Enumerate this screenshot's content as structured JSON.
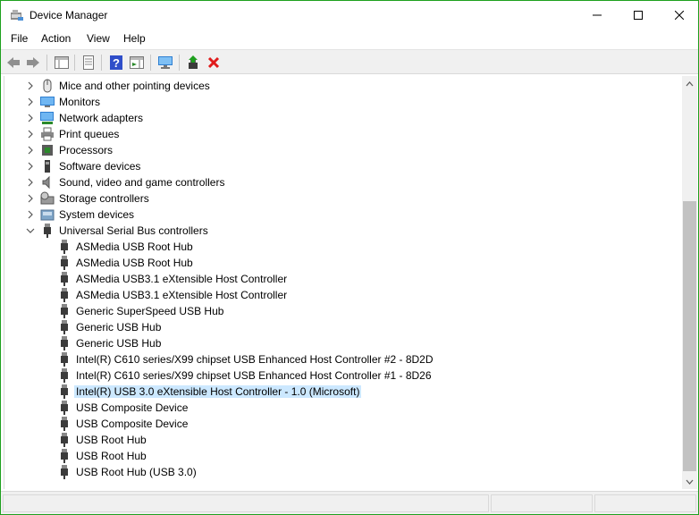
{
  "window": {
    "title": "Device Manager"
  },
  "menu": [
    "File",
    "Action",
    "View",
    "Help"
  ],
  "toolbar": {
    "buttons": [
      "back-arrow-icon",
      "forward-arrow-icon",
      "show-hide-console-tree-icon",
      "properties-icon",
      "help-icon",
      "action-pane-icon",
      "scan-hardware-icon",
      "update-driver-icon",
      "uninstall-device-icon"
    ]
  },
  "tree": {
    "categories": [
      {
        "label": "Mice and other pointing devices",
        "icon": "mouse-icon"
      },
      {
        "label": "Monitors",
        "icon": "monitor-icon"
      },
      {
        "label": "Network adapters",
        "icon": "network-adapter-icon"
      },
      {
        "label": "Print queues",
        "icon": "printer-icon"
      },
      {
        "label": "Processors",
        "icon": "processor-icon"
      },
      {
        "label": "Software devices",
        "icon": "software-device-icon"
      },
      {
        "label": "Sound, video and game controllers",
        "icon": "speaker-icon"
      },
      {
        "label": "Storage controllers",
        "icon": "storage-controller-icon"
      },
      {
        "label": "System devices",
        "icon": "system-device-icon"
      },
      {
        "label": "Universal Serial Bus controllers",
        "icon": "usb-icon"
      }
    ],
    "usb_devices": [
      "ASMedia USB Root Hub",
      "ASMedia USB Root Hub",
      "ASMedia USB3.1 eXtensible Host Controller",
      "ASMedia USB3.1 eXtensible Host Controller",
      "Generic SuperSpeed USB Hub",
      "Generic USB Hub",
      "Generic USB Hub",
      "Intel(R) C610 series/X99 chipset USB Enhanced Host Controller #2 - 8D2D",
      "Intel(R) C610 series/X99 chipset USB Enhanced Host Controller #1 - 8D26",
      "Intel(R) USB 3.0 eXtensible Host Controller - 1.0 (Microsoft)",
      "USB Composite Device",
      "USB Composite Device",
      "USB Root Hub",
      "USB Root Hub",
      "USB Root Hub (USB 3.0)"
    ],
    "selected": "Intel(R) USB 3.0 eXtensible Host Controller - 1.0 (Microsoft)",
    "colors": {
      "selection": "#cce8ff",
      "accent": "#1ea01e"
    }
  }
}
